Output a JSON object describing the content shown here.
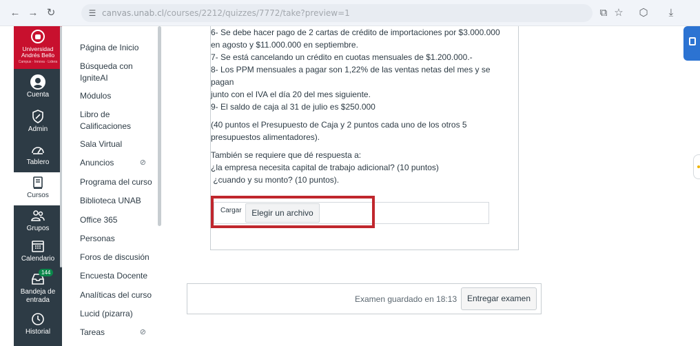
{
  "browser": {
    "url_host": "canvas.unab.cl",
    "url_path": "/courses/2212/quizzes/7772/take?preview=1"
  },
  "global_nav": {
    "logo_name": "Universidad Andrés Bello",
    "logo_tagline": "Campus · Innova · Lidera",
    "items": [
      {
        "label": "Cuenta",
        "icon": "account-icon"
      },
      {
        "label": "Admin",
        "icon": "admin-icon"
      },
      {
        "label": "Tablero",
        "icon": "dashboard-icon"
      },
      {
        "label": "Cursos",
        "icon": "courses-icon"
      },
      {
        "label": "Grupos",
        "icon": "groups-icon"
      },
      {
        "label": "Calendario",
        "icon": "calendar-icon"
      },
      {
        "label": "Bandeja de entrada",
        "icon": "inbox-icon",
        "badge": "144"
      },
      {
        "label": "Historial",
        "icon": "history-icon"
      }
    ]
  },
  "course_nav": {
    "items": [
      {
        "label": "Página de Inicio"
      },
      {
        "label": "Búsqueda con IgniteAI"
      },
      {
        "label": "Módulos"
      },
      {
        "label": "Libro de Calificaciones"
      },
      {
        "label": "Sala Virtual"
      },
      {
        "label": "Anuncios",
        "hidden": true
      },
      {
        "label": "Programa del curso"
      },
      {
        "label": "Biblioteca UNAB"
      },
      {
        "label": "Office 365"
      },
      {
        "label": "Personas"
      },
      {
        "label": "Foros de discusión"
      },
      {
        "label": "Encuesta Docente"
      },
      {
        "label": "Analíticas del curso"
      },
      {
        "label": "Lucid (pizarra)"
      },
      {
        "label": "Tareas",
        "hidden": true
      }
    ]
  },
  "question": {
    "lines": [
      "6- Se debe hacer pago de 2 cartas de crédito de importaciones por $3.000.000",
      "en agosto y $11.000.000 en septiembre.",
      "7- Se está cancelando un crédito en cuotas mensuales de $1.200.000.-",
      "8- Los PPM mensuales a pagar son 1,22% de las ventas netas del mes y se pagan",
      "junto con el IVA el día 20 del mes siguiente.",
      "9- El saldo de caja al 31 de julio es $250.000"
    ],
    "points_note_1": "(40 puntos el Presupuesto de Caja y 2 puntos cada uno de los otros 5",
    "points_note_2": "presupuestos alimentadores).",
    "extra_1": "También se requiere que dé respuesta a:",
    "extra_2": "¿la empresa necesita capital de trabajo adicional? (10 puntos)",
    "extra_3": " ¿cuando y su monto? (10 puntos)."
  },
  "upload": {
    "label": "Cargar",
    "button": "Elegir un archivo"
  },
  "footer": {
    "saved_text": "Examen guardado en 18:13",
    "submit_label": "Entregar examen"
  }
}
